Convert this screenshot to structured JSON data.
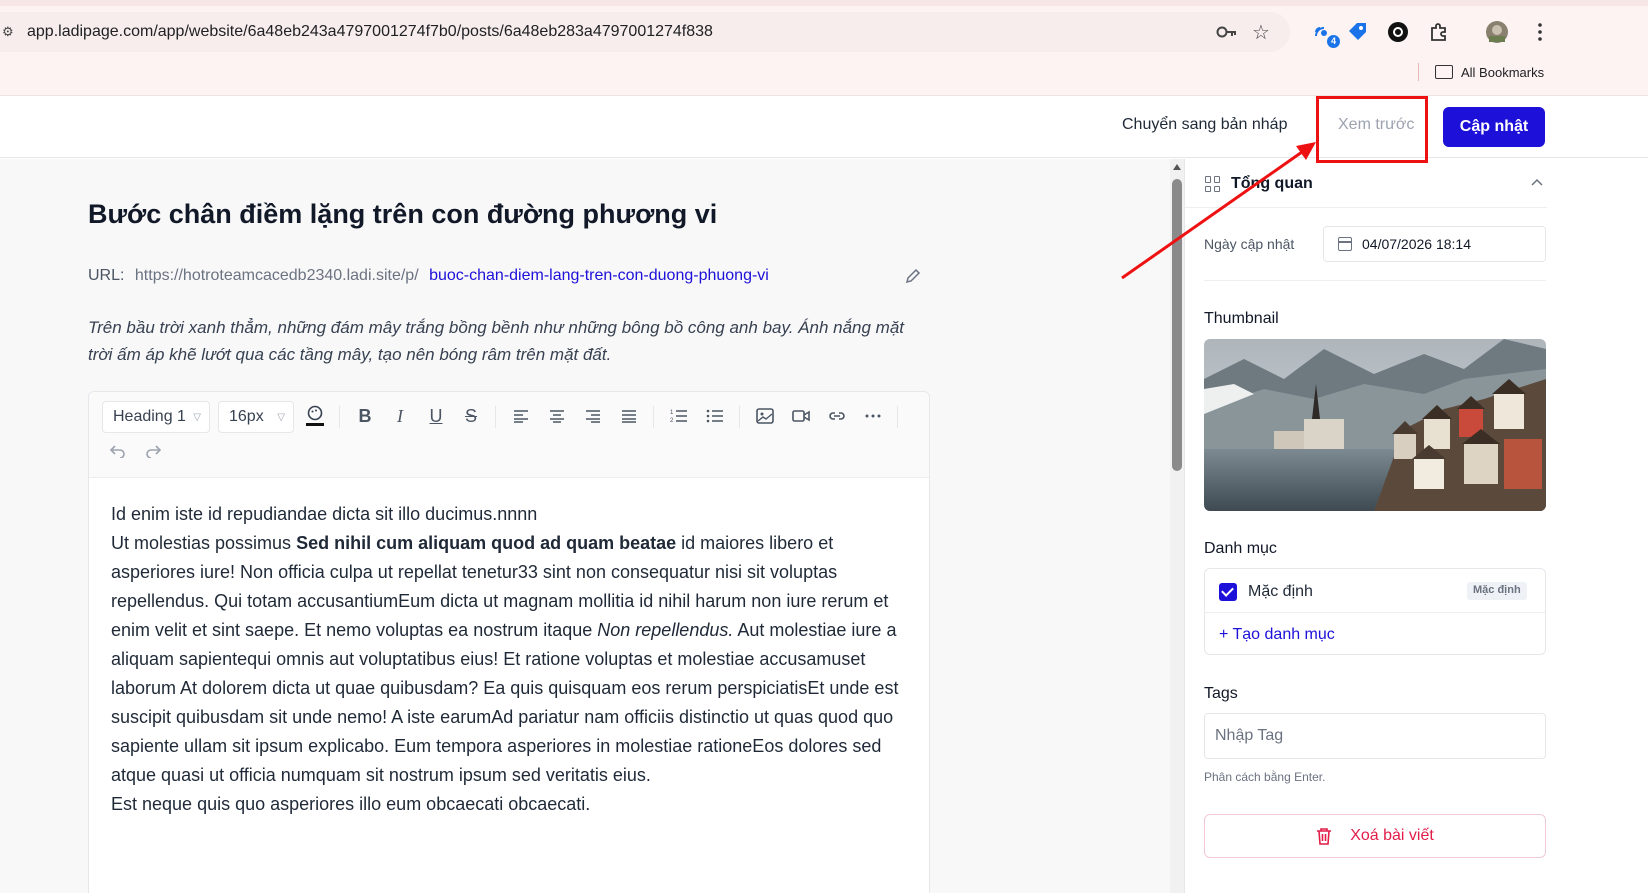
{
  "browser": {
    "url": "app.ladipage.com/app/website/6a48eb243a4797001274f7b0/posts/6a48eb283a4797001274f838",
    "bookmarks_label": "All Bookmarks",
    "extension_badge": "4"
  },
  "header": {
    "draft_label": "Chuyển sang bản nháp",
    "preview_label": "Xem trước",
    "update_label": "Cập nhật"
  },
  "post": {
    "title": "Bước chân điềm lặng trên con đường phương vi",
    "url_label": "URL:",
    "url_base": "https://hotroteamcacedb2340.ladi.site/p/",
    "url_slug": "buoc-chan-diem-lang-tren-con-duong-phuong-vi",
    "excerpt": "Trên bầu trời xanh thẳm, những đám mây trắng bồng bềnh như những bông bồ công anh bay. Ánh nắng mặt trời ấm áp khẽ lướt qua các tầng mây, tạo nên bóng râm trên mặt đất."
  },
  "toolbar": {
    "heading_select": "Heading 1",
    "size_select": "16px"
  },
  "content": {
    "line1": "Id enim iste id repudiandae dicta sit illo ducimus.nnnn",
    "p2_start": "Ut molestias possimus ",
    "p2_bold": "Sed nihil cum aliquam quod ad quam beatae",
    "p2_mid": " id maiores libero et asperiores iure! Non officia culpa ut repellat tenetur33 sint non consequatur nisi sit voluptas repellendus. Qui totam accusantiumEum dicta ut magnam mollitia id nihil harum non iure rerum et enim velit et sint saepe. Et nemo voluptas ea nostrum itaque ",
    "p2_italic": "Non repellendus.",
    "p2_end": " Aut molestiae iure a aliquam sapientequi omnis aut voluptatibus eius! Et ratione voluptas et molestiae accusamuset laborum At dolorem dicta ut quae quibusdam? Ea quis quisquam eos rerum perspiciatisEt unde est suscipit quibusdam sit unde nemo! A iste earumAd pariatur nam officiis distinctio ut quas quod quo sapiente ullam sit ipsum explicabo. Eum tempora asperiores in molestiae rationeEos dolores sed atque quasi ut officia numquam sit nostrum ipsum sed veritatis eius.",
    "line3": "Est neque quis quo asperiores illo eum obcaecati obcaecati."
  },
  "sidebar": {
    "overview_title": "Tổng quan",
    "date_label": "Ngày cập nhật",
    "date_value": "04/07/2026 18:14",
    "thumbnail_label": "Thumbnail",
    "category_label": "Danh mục",
    "category_name": "Mặc định",
    "category_badge": "Mặc định",
    "add_category": "+ Tạo danh mục",
    "tags_label": "Tags",
    "tags_placeholder": "Nhập Tag",
    "tags_hint": "Phân cách bằng Enter.",
    "delete_label": "Xoá bài viết"
  },
  "colors": {
    "primary": "#1d10d9",
    "annotation": "#ee1111",
    "danger": "#e11d48"
  }
}
